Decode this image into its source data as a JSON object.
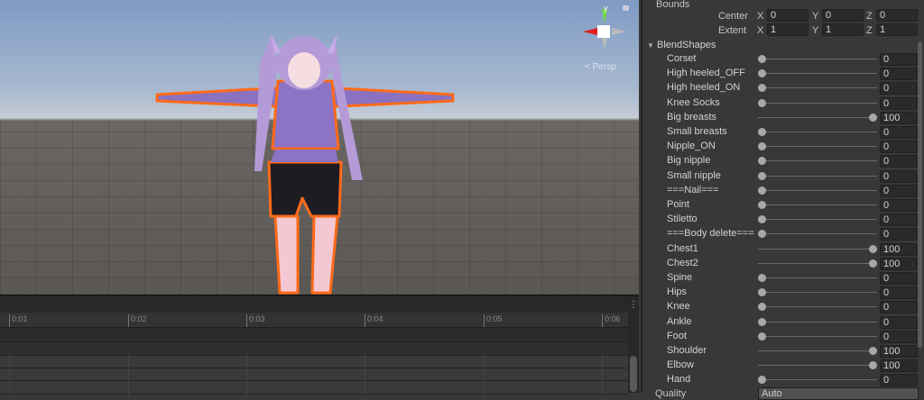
{
  "scene": {
    "gizmo": {
      "x_label": "x",
      "y_label": "y"
    },
    "projection_label": "Persp"
  },
  "timeline": {
    "ticks": [
      "0:01",
      "0:02",
      "0:03",
      "0:04",
      "0:05",
      "0:06"
    ]
  },
  "inspector": {
    "bounds_label": "Bounds",
    "center": {
      "label": "Center",
      "x": "0",
      "y": "0",
      "z": "0"
    },
    "extent": {
      "label": "Extent",
      "x": "1",
      "y": "1",
      "z": "1"
    },
    "axis": {
      "x": "X",
      "y": "Y",
      "z": "Z"
    },
    "blendshapes_label": "BlendShapes",
    "blendshapes": [
      {
        "name": "Corset",
        "value": 0
      },
      {
        "name": "High heeled_OFF",
        "value": 0
      },
      {
        "name": "High heeled_ON",
        "value": 0
      },
      {
        "name": "Knee Socks",
        "value": 0
      },
      {
        "name": "Big breasts",
        "value": 100
      },
      {
        "name": "Small breasts",
        "value": 0
      },
      {
        "name": "Nipple_ON",
        "value": 0
      },
      {
        "name": "Big nipple",
        "value": 0
      },
      {
        "name": "Small nipple",
        "value": 0
      },
      {
        "name": "===Nail===",
        "value": 0
      },
      {
        "name": "Point",
        "value": 0
      },
      {
        "name": "Stiletto",
        "value": 0
      },
      {
        "name": "===Body delete===",
        "value": 0
      },
      {
        "name": "Chest1",
        "value": 100
      },
      {
        "name": "Chest2",
        "value": 100
      },
      {
        "name": "Spine",
        "value": 0
      },
      {
        "name": "Hips",
        "value": 0
      },
      {
        "name": "Knee",
        "value": 0
      },
      {
        "name": "Ankle",
        "value": 0
      },
      {
        "name": "Foot",
        "value": 0
      },
      {
        "name": "Shoulder",
        "value": 100
      },
      {
        "name": "Elbow",
        "value": 100
      },
      {
        "name": "Hand",
        "value": 0
      }
    ],
    "quality": {
      "label": "Quality",
      "value": "Auto"
    }
  }
}
